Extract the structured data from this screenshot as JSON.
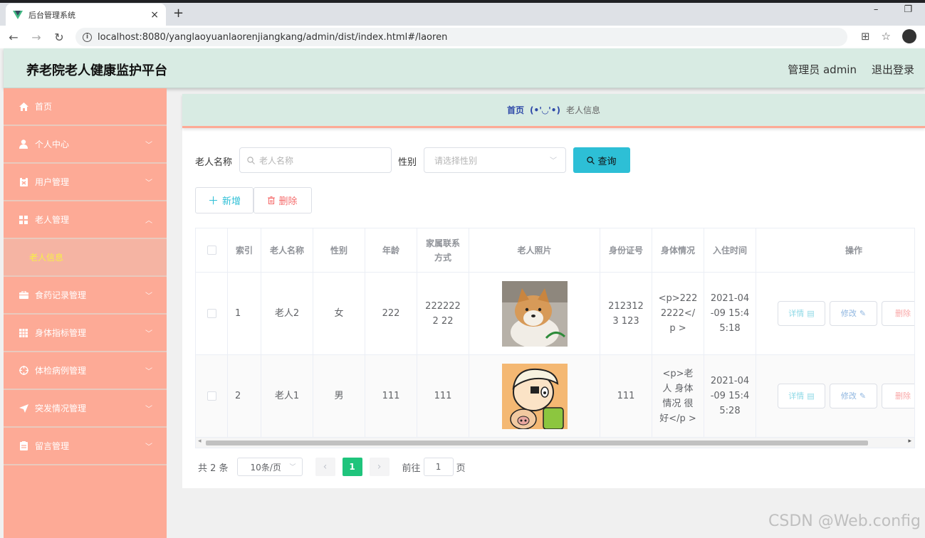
{
  "browser": {
    "tab_title": "后台管理系统",
    "tab_close": "×",
    "new_tab": "+",
    "url": "localhost:8080/yanglaoyuanlaorenjiangkang/admin/dist/index.html#/laoren"
  },
  "header": {
    "brand": "养老院老人健康监护平台",
    "admin_label": "管理员 admin",
    "logout": "退出登录"
  },
  "sidebar": {
    "items": [
      {
        "label": "首页",
        "icon": "home-icon"
      },
      {
        "label": "个人中心",
        "icon": "user-icon"
      },
      {
        "label": "用户管理",
        "icon": "clipboard-icon"
      },
      {
        "label": "老人管理",
        "icon": "grid-icon"
      },
      {
        "label": "老人信息",
        "icon": ""
      },
      {
        "label": "食药记录管理",
        "icon": "briefcase-icon"
      },
      {
        "label": "身体指标管理",
        "icon": "table-icon"
      },
      {
        "label": "体检病例管理",
        "icon": "target-icon"
      },
      {
        "label": "突发情况管理",
        "icon": "send-icon"
      },
      {
        "label": "留言管理",
        "icon": "note-icon"
      }
    ]
  },
  "breadcrumb": {
    "home": "首页",
    "separator": "(•'◡'•)",
    "current": "老人信息"
  },
  "search": {
    "name_label": "老人名称",
    "name_placeholder": "老人名称",
    "gender_label": "性别",
    "gender_placeholder": "请选择性别",
    "query_btn": "查询"
  },
  "actions": {
    "add": "新增",
    "delete": "删除"
  },
  "table": {
    "headers": [
      "索引",
      "老人名称",
      "性别",
      "年龄",
      "家属联系方式",
      "老人照片",
      "身份证号",
      "身体情况",
      "入住时间",
      "操作"
    ],
    "rows": [
      {
        "index": "1",
        "name": "老人2",
        "gender": "女",
        "age": "222",
        "contact": "2222222 22",
        "photo": "shiba-dog-photo",
        "idcard": "2123123 123",
        "health": "<p>222 2222</p >",
        "checkin": "2021-04 -09 15:4 5:18"
      },
      {
        "index": "2",
        "name": "老人1",
        "gender": "男",
        "age": "111",
        "contact": "111",
        "photo": "cartoon-boy-photo",
        "idcard": "111",
        "health": "<p>老人 身体情况 很好</p >",
        "checkin": "2021-04 -09 15:4 5:28"
      }
    ],
    "op_detail": "详情",
    "op_edit": "修改",
    "op_delete": "删除"
  },
  "pagination": {
    "total": "共 2 条",
    "page_size": "10条/页",
    "current_page": "1",
    "goto_label": "前往",
    "goto_value": "1",
    "page_unit": "页"
  },
  "watermark": "CSDN @Web.config",
  "colors": {
    "sidebar_bg": "#fdaa96",
    "header_bg": "#d8ebe3",
    "query_btn": "#2dbfd6",
    "page_active": "#1fc47c",
    "submenu_text": "#f7f045"
  }
}
